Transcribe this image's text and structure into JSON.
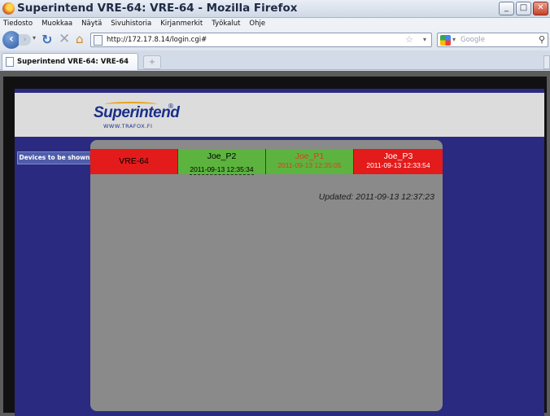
{
  "window": {
    "title": "Superintend VRE-64: VRE-64 - Mozilla Firefox"
  },
  "menu": [
    "Tiedosto",
    "Muokkaa",
    "Näytä",
    "Sivuhistoria",
    "Kirjanmerkit",
    "Työkalut",
    "Ohje"
  ],
  "nav": {
    "url": "http://172.17.8.14/login.cgi#",
    "search_placeholder": "Google"
  },
  "tabs": [
    {
      "label": "Superintend VRE-64: VRE-64"
    }
  ],
  "newtab_label": "+",
  "page": {
    "logo": {
      "name": "Superintend",
      "sub": "WWW.TRAFOX.FI",
      "reg": "®"
    },
    "sidebar": {
      "devices_button": "Devices to be shown"
    },
    "devices": [
      {
        "name": "VRE-64",
        "time": "",
        "status": "red",
        "name_color": "#000000",
        "time_color": "#000000"
      },
      {
        "name": "Joe_P2",
        "time": "2011-09-13 12:35:34",
        "status": "green",
        "name_color": "#000000",
        "time_color": "#000000"
      },
      {
        "name": "Joe_P1",
        "time": "2011-09-13 12:35:05",
        "status": "green",
        "name_color": "#e43a1c",
        "time_color": "#e43a1c"
      },
      {
        "name": "Joe_P3",
        "time": "2011-09-13 12:33:54",
        "status": "red",
        "name_color": "#ffffff",
        "time_color": "#ffffff"
      }
    ],
    "updated": "Updated: 2011-09-13 12:37:23"
  },
  "colors": {
    "page_bg": "#2a2a80",
    "panel_bg": "#8a8a8a",
    "status_red": "#e31b1b",
    "status_green": "#5cb43e"
  }
}
